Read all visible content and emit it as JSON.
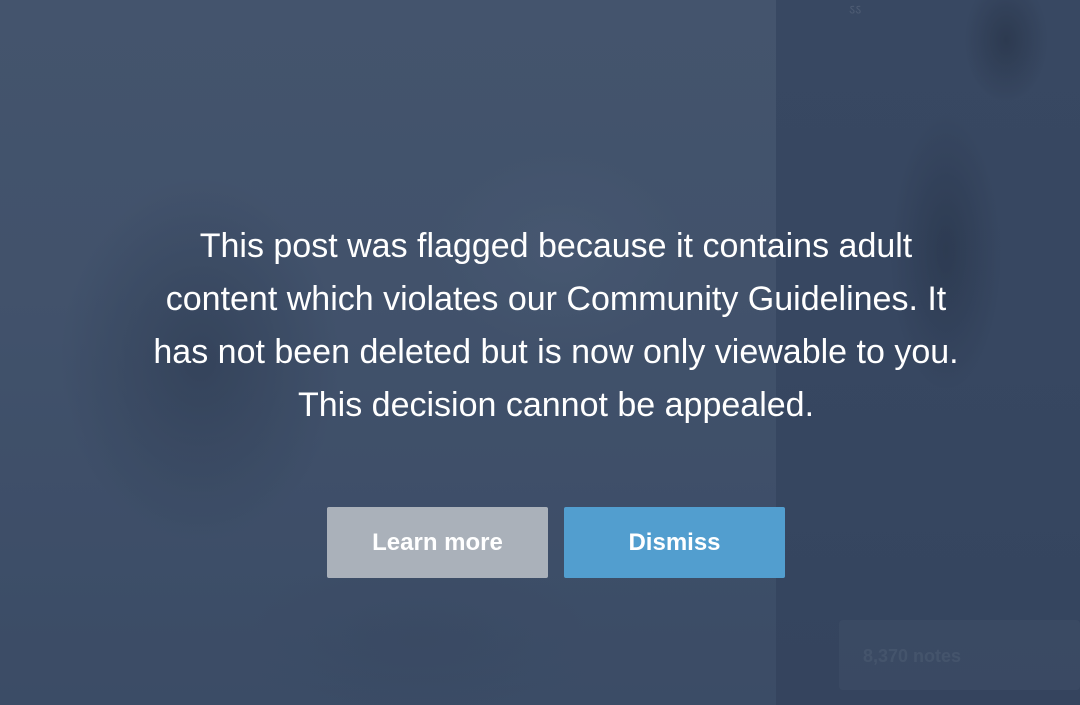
{
  "background": {
    "top_label": "ऽऽ",
    "notes_count": "8,370 notes"
  },
  "flag_notice": {
    "message": "This post was flagged because it contains adult content which violates our Community Guidelines. It has not been deleted but is now only viewable to you. This decision cannot be appealed.",
    "learn_more_label": "Learn more",
    "dismiss_label": "Dismiss"
  },
  "colors": {
    "overlay": "#324360",
    "learn_more_button": "#aab1ba",
    "dismiss_button": "#529ecf",
    "text": "#ffffff"
  }
}
